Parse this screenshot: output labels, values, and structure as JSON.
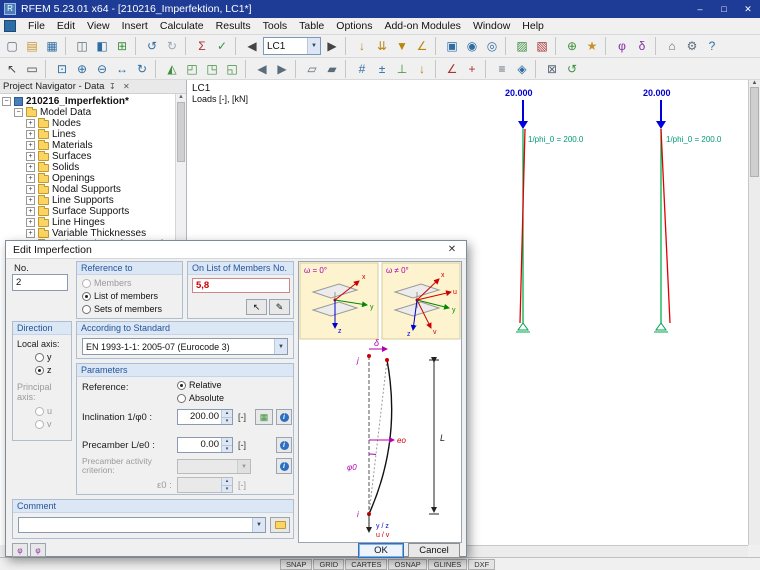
{
  "window": {
    "title": "RFEM 5.23.01 x64 - [210216_Imperfektion, LC1*]",
    "minimize": "–",
    "maximize": "□",
    "close": "✕",
    "app_initial": "R"
  },
  "menubar": {
    "items": [
      "File",
      "Edit",
      "View",
      "Insert",
      "Calculate",
      "Results",
      "Tools",
      "Table",
      "Options",
      "Add-on Modules",
      "Window",
      "Help"
    ]
  },
  "toolbar": {
    "lc_selector": "LC1",
    "row1_left": [
      {
        "n": "new-file",
        "g": "▢",
        "c": "#5a6b7a"
      },
      {
        "n": "open-file",
        "g": "▤",
        "c": "#c8922a"
      },
      {
        "n": "save",
        "g": "▦",
        "c": "#2e6da4"
      },
      "|",
      {
        "n": "print",
        "g": "◫",
        "c": "#5a6b7a"
      },
      {
        "n": "navigator-toggle",
        "g": "◧",
        "c": "#2e6da4"
      },
      {
        "n": "tables-toggle",
        "g": "⊞",
        "c": "#3f8f3f"
      },
      "|",
      {
        "n": "undo",
        "g": "↺",
        "c": "#2e6da4"
      },
      {
        "n": "redo",
        "g": "↻",
        "c": "#9aa7b5"
      },
      "|",
      {
        "n": "calculation",
        "g": "Σ",
        "c": "#a33"
      },
      {
        "n": "check-data",
        "g": "✓",
        "c": "#3f8f3f"
      },
      "|",
      {
        "n": "loadcase-previous",
        "g": "◀",
        "c": "#444"
      }
    ],
    "row1_right": [
      {
        "n": "loadcase-next",
        "g": "▶",
        "c": "#444"
      },
      "|",
      {
        "n": "nodal-load",
        "g": "↓",
        "c": "#b8860b"
      },
      {
        "n": "member-load",
        "g": "⇊",
        "c": "#b8860b"
      },
      {
        "n": "surface-load",
        "g": "▼",
        "c": "#b8860b"
      },
      {
        "n": "imperfection",
        "g": "∠",
        "c": "#b8860b"
      },
      "|",
      {
        "n": "new-window",
        "g": "▣",
        "c": "#2e6da4"
      },
      {
        "n": "visibility",
        "g": "◉",
        "c": "#2e6da4"
      },
      {
        "n": "user-views",
        "g": "◎",
        "c": "#2e6da4"
      },
      "|",
      {
        "n": "generate-mesh",
        "g": "▨",
        "c": "#3f8f3f"
      },
      {
        "n": "delete-mesh",
        "g": "▧",
        "c": "#a33"
      },
      "|",
      {
        "n": "add-module",
        "g": "⊕",
        "c": "#3f8f3f"
      },
      {
        "n": "favorites",
        "g": "★",
        "c": "#c8922a"
      },
      "|",
      {
        "n": "phi-display",
        "g": "φ",
        "c": "#8b2fa8"
      },
      {
        "n": "delta-display",
        "g": "δ",
        "c": "#8b2fa8"
      },
      "|",
      {
        "n": "home-view",
        "g": "⌂",
        "c": "#5a6b7a"
      },
      {
        "n": "settings",
        "g": "⚙",
        "c": "#5a6b7a"
      },
      {
        "n": "help",
        "g": "?",
        "c": "#2e6da4"
      }
    ],
    "row2": [
      {
        "n": "select-arrow",
        "g": "↖",
        "c": "#444"
      },
      {
        "n": "select-box",
        "g": "▭",
        "c": "#444"
      },
      "|",
      {
        "n": "zoom-window",
        "g": "⊡",
        "c": "#2e6da4"
      },
      {
        "n": "zoom-in",
        "g": "⊕",
        "c": "#2e6da4"
      },
      {
        "n": "zoom-out",
        "g": "⊖",
        "c": "#2e6da4"
      },
      {
        "n": "pan",
        "g": "↔",
        "c": "#2e6da4"
      },
      {
        "n": "rotate-view",
        "g": "↻",
        "c": "#2e6da4"
      },
      "|",
      {
        "n": "view-isometric",
        "g": "◭",
        "c": "#3f8f3f"
      },
      {
        "n": "view-in-x",
        "g": "◰",
        "c": "#3f8f3f"
      },
      {
        "n": "view-in-y",
        "g": "◳",
        "c": "#3f8f3f"
      },
      {
        "n": "view-in-z",
        "g": "◱",
        "c": "#3f8f3f"
      },
      "|",
      {
        "n": "previous-view",
        "g": "◀",
        "c": "#5a6b7a"
      },
      {
        "n": "next-view",
        "g": "▶",
        "c": "#5a6b7a"
      },
      "|",
      {
        "n": "wireframe-display",
        "g": "▱",
        "c": "#5a6b7a"
      },
      {
        "n": "solid-display",
        "g": "▰",
        "c": "#5a6b7a"
      },
      "|",
      {
        "n": "show-numbering",
        "g": "#",
        "c": "#2e6da4"
      },
      {
        "n": "show-values",
        "g": "±",
        "c": "#2e6da4"
      },
      {
        "n": "show-supports",
        "g": "⊥",
        "c": "#3f8f3f"
      },
      {
        "n": "show-loads",
        "g": "↓",
        "c": "#b8860b"
      },
      "|",
      {
        "n": "measure",
        "g": "∠",
        "c": "#a33"
      },
      {
        "n": "coordinate-system",
        "g": "+",
        "c": "#a33"
      },
      "|",
      {
        "n": "background-layers",
        "g": "≡",
        "c": "#5a6b7a"
      },
      {
        "n": "display-properties",
        "g": "◈",
        "c": "#2e6da4"
      },
      "|",
      {
        "n": "full-screen",
        "g": "⊠",
        "c": "#5a6b7a"
      },
      {
        "n": "refresh-view",
        "g": "↺",
        "c": "#3f8f3f"
      }
    ]
  },
  "navigator": {
    "title": "Project Navigator - Data",
    "root": "210216_Imperfektion*",
    "model_data": "Model Data",
    "items": [
      "Nodes",
      "Lines",
      "Materials",
      "Surfaces",
      "Solids",
      "Openings",
      "Nodal Supports",
      "Line Supports",
      "Surface Supports",
      "Line Hinges",
      "Variable Thicknesses",
      "Orthotropic Surfaces and Membrane"
    ]
  },
  "canvas": {
    "lc_label": "LC1",
    "loads_label": "Loads [-], [kN]",
    "member1": {
      "load": "20.000",
      "phi": "1/phi_0 = 200.0"
    },
    "member2": {
      "load": "20.000",
      "phi": "1/phi_0 = 200.0"
    }
  },
  "dialog": {
    "title": "Edit Imperfection",
    "no": {
      "label": "No.",
      "value": "2"
    },
    "reference_to": {
      "title": "Reference to",
      "members": "Members",
      "list": "List of members",
      "sets": "Sets of members"
    },
    "on_list": {
      "title": "On List of Members No.",
      "value": "5,8"
    },
    "direction": {
      "title": "Direction",
      "local": "Local axis:",
      "y": "y",
      "z": "z",
      "principal": "Principal axis:",
      "u": "u",
      "v": "v"
    },
    "standard": {
      "title": "According to Standard",
      "value": "EN 1993-1-1: 2005-07 (Eurocode 3)"
    },
    "parameters": {
      "title": "Parameters",
      "reference": "Reference:",
      "relative": "Relative",
      "absolute": "Absolute",
      "inclination": "Inclination 1/φ0 :",
      "inclination_value": "200.00",
      "precamber": "Precamber L/e0 :",
      "precamber_value": "0.00",
      "criterion_line1": "Precamber activity",
      "criterion_line2": "criterion:",
      "eps": "ε0 :",
      "unit": "[-]"
    },
    "comment": {
      "title": "Comment"
    },
    "buttons": {
      "ok": "OK",
      "cancel": "Cancel"
    },
    "image": {
      "omega_zero": "ω = 0°",
      "omega_nonzero": "ω ≠ 0°",
      "x": "x",
      "y": "y",
      "z": "z",
      "u": "u",
      "v": "v",
      "delta": "δ",
      "e0": "eo",
      "L": "L",
      "phi0": "φ0",
      "j": "j",
      "i": "i",
      "yz": "y / z",
      "uv": "u / v"
    }
  },
  "statusbar": {
    "buttons": [
      "SNAP",
      "GRID",
      "CARTES",
      "OSNAP",
      "GLINES",
      "DXF"
    ]
  }
}
